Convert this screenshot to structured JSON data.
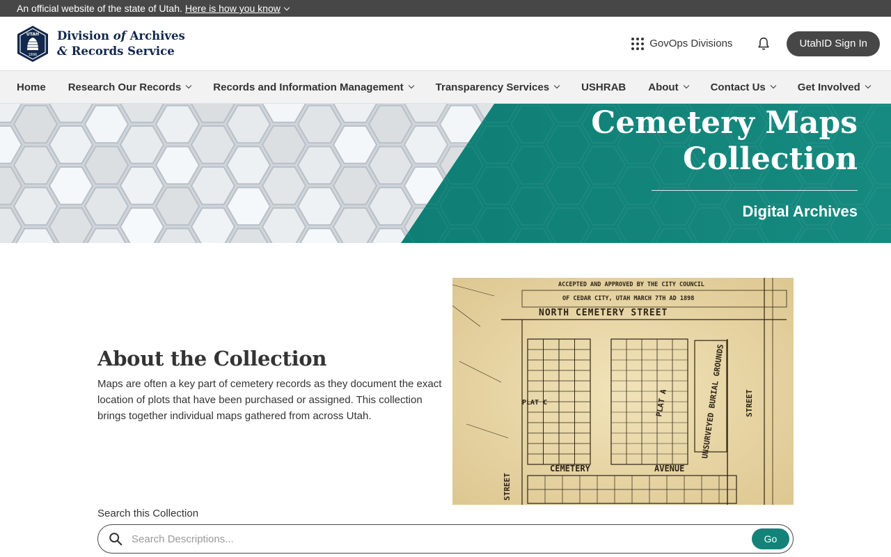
{
  "gov_banner": {
    "text": "An official website of the state of Utah.",
    "link": "Here is how you know"
  },
  "header": {
    "seal_top": "UTAH",
    "seal_year": "1896",
    "logo_line1a": "Division",
    "logo_line1b": "of",
    "logo_line1c": "Archives",
    "logo_line2a": "&",
    "logo_line2b": "Records Service",
    "govops": "GovOps Divisions",
    "signin": "UtahID Sign In"
  },
  "nav": {
    "items": [
      {
        "label": "Home",
        "dropdown": false
      },
      {
        "label": "Research Our Records",
        "dropdown": true
      },
      {
        "label": "Records and Information Management",
        "dropdown": true
      },
      {
        "label": "Transparency Services",
        "dropdown": true
      },
      {
        "label": "USHRAB",
        "dropdown": false
      },
      {
        "label": "About",
        "dropdown": true
      },
      {
        "label": "Contact Us",
        "dropdown": true
      },
      {
        "label": "Get Involved",
        "dropdown": true
      }
    ]
  },
  "hero": {
    "title_line1": "Cemetery Maps",
    "title_line2": "Collection",
    "subtitle": "Digital Archives"
  },
  "about": {
    "heading": "About the Collection",
    "body": "Maps are often a key part of cemetery records as they document the exact location of plots that have been purchased or assigned. This collection brings together individual maps gathered from across Utah."
  },
  "map": {
    "caption1": "ACCEPTED AND APPROVED BY THE CITY COUNCIL",
    "caption2": "OF CEDAR CITY, UTAH    MARCH  7TH AD 1898",
    "street_north": "NORTH    CEMETERY    STREET",
    "street_west": "STREET",
    "street_south": "CEMETERY",
    "avenue": "AVENUE",
    "plat_c": "PLAT C",
    "plat_a": "PLAT A",
    "burial": "UNSURVEYED BURIAL GROUNDS",
    "street_east": "STREET"
  },
  "search": {
    "label": "Search this Collection",
    "placeholder": "Search Descriptions...",
    "button": "Go"
  },
  "colors": {
    "teal": "#13837a",
    "navy": "#12284c",
    "dark_gray": "#474747"
  }
}
